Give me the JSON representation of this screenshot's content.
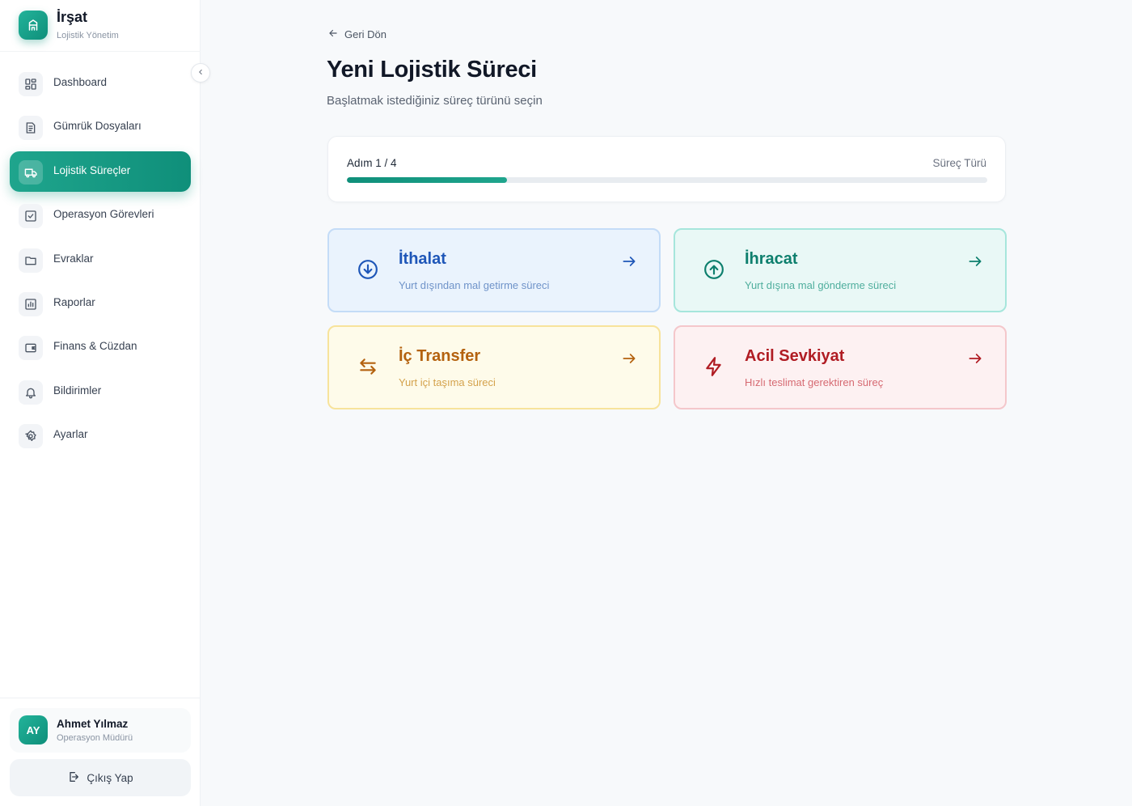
{
  "brand": {
    "name": "İrşat",
    "subtitle": "Lojistik Yönetim"
  },
  "sidebar": {
    "items": [
      {
        "label": "Dashboard",
        "icon": "dashboard-grid-icon",
        "active": false
      },
      {
        "label": "Gümrük Dosyaları",
        "icon": "document-list-icon",
        "active": false
      },
      {
        "label": "Lojistik Süreçler",
        "icon": "truck-icon",
        "active": true
      },
      {
        "label": "Operasyon Görevleri",
        "icon": "checkbox-icon",
        "active": false
      },
      {
        "label": "Evraklar",
        "icon": "folder-icon",
        "active": false
      },
      {
        "label": "Raporlar",
        "icon": "bar-chart-icon",
        "active": false
      },
      {
        "label": "Finans & Cüzdan",
        "icon": "wallet-icon",
        "active": false
      },
      {
        "label": "Bildirimler",
        "icon": "bell-icon",
        "active": false
      },
      {
        "label": "Ayarlar",
        "icon": "gear-icon",
        "active": false
      }
    ]
  },
  "user": {
    "initials": "AY",
    "name": "Ahmet Yılmaz",
    "role": "Operasyon Müdürü",
    "logout_label": "Çıkış Yap"
  },
  "main": {
    "back_label": "Geri Dön",
    "title": "Yeni Lojistik Süreci",
    "subtitle": "Başlatmak istediğiniz süreç türünü seçin",
    "progress": {
      "step_label": "Adım 1 / 4",
      "step_name": "Süreç Türü",
      "fraction": 0.25
    },
    "options": [
      {
        "title": "İthalat",
        "desc": "Yurt dışından mal getirme süreci",
        "icon": "arrow-down-circle-icon",
        "color": "#1e56b8"
      },
      {
        "title": "İhracat",
        "desc": "Yurt dışına mal gönderme süreci",
        "icon": "arrow-up-circle-icon",
        "color": "#0d7f6d"
      },
      {
        "title": "İç Transfer",
        "desc": "Yurt içi taşıma süreci",
        "icon": "swap-arrows-icon",
        "color": "#b4620f"
      },
      {
        "title": "Acil Sevkiyat",
        "desc": "Hızlı teslimat gerektiren süreç",
        "icon": "lightning-icon",
        "color": "#b01c23"
      }
    ]
  },
  "colors": {
    "accent": "#0f8f7a",
    "accent_light": "#1fa58d"
  }
}
